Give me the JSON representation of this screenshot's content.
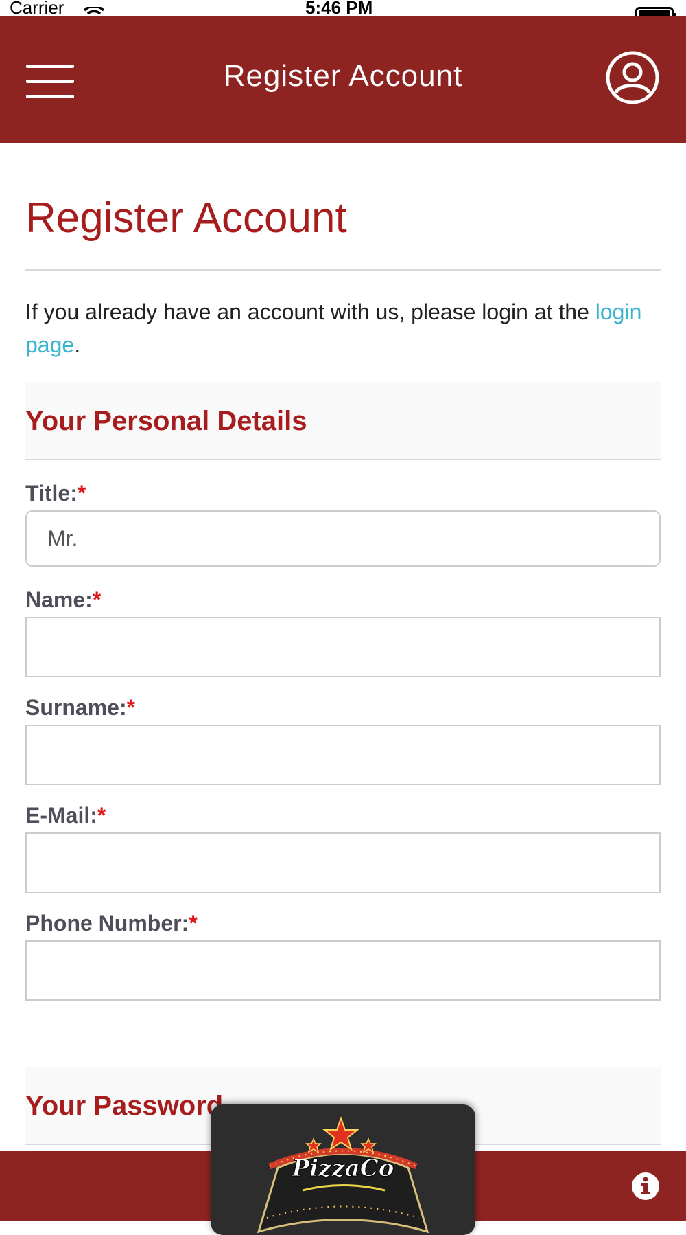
{
  "status_bar": {
    "carrier": "Carrier",
    "time": "5:46 PM"
  },
  "header": {
    "title": "Register Account"
  },
  "page": {
    "title": "Register Account",
    "intro_text": "If you already have an account with us, please login at the ",
    "login_link": "login page",
    "intro_end": "."
  },
  "personal_section": {
    "heading": "Your Personal Details",
    "title_label": "Title:",
    "title_value": "Mr.",
    "name_label": "Name:",
    "surname_label": "Surname:",
    "email_label": "E-Mail:",
    "phone_label": "Phone Number:",
    "required_mark": "*"
  },
  "password_section": {
    "heading": "Your Password"
  },
  "footer": {
    "logo_text": "PizzaCo"
  },
  "colors": {
    "brand": "#8e2422",
    "heading": "#a71d1d",
    "link": "#3ab4cf",
    "required": "#e0161c"
  }
}
